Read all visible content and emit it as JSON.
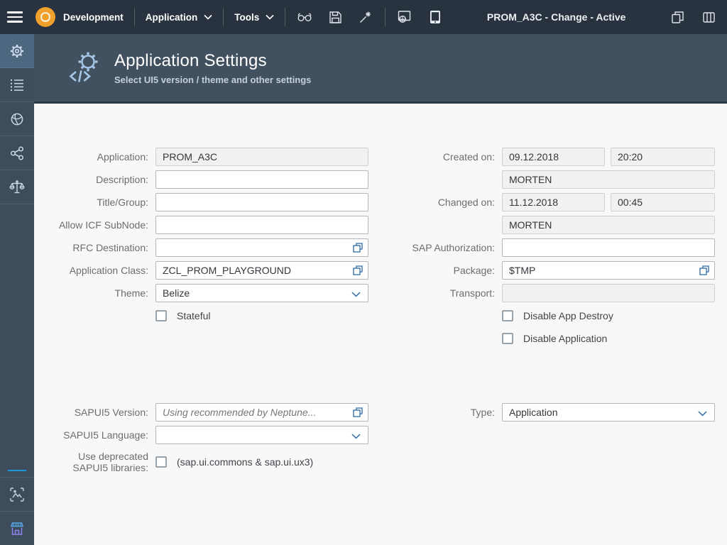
{
  "topbar": {
    "product": "Development",
    "menu_application": "Application",
    "menu_tools": "Tools",
    "title": "PROM_A3C - Change - Active",
    "icons": [
      "hamburger-icon",
      "glasses-icon",
      "save-icon",
      "wand-icon",
      "browser-preview-icon",
      "tablet-icon",
      "copy-icon",
      "columns-icon"
    ]
  },
  "sidebar": {
    "items": [
      "settings",
      "list",
      "globe",
      "share",
      "scales"
    ],
    "bottom_items": [
      "image-capture",
      "store"
    ],
    "active_item": "settings",
    "accent_line_color": "#1e97dd"
  },
  "header": {
    "title": "Application Settings",
    "subtitle": "Select UI5 version / theme and other settings",
    "icon": "gear-code-icon"
  },
  "colors": {
    "topbar_bg": "#28333f",
    "sidebar_bg": "#3e4d5c",
    "header_bg": "#42515f",
    "accent_blue": "#2b69a8",
    "logo_orange": "#efa12c"
  },
  "form": {
    "application": {
      "label": "Application:",
      "value": "PROM_A3C"
    },
    "description": {
      "label": "Description:",
      "value": ""
    },
    "title_group": {
      "label": "Title/Group:",
      "value": ""
    },
    "allow_icf": {
      "label": "Allow ICF SubNode:",
      "value": ""
    },
    "rfc_destination": {
      "label": "RFC Destination:",
      "value": ""
    },
    "application_class": {
      "label": "Application Class:",
      "value": "ZCL_PROM_PLAYGROUND"
    },
    "theme": {
      "label": "Theme:",
      "value": "Belize"
    },
    "stateful": {
      "label": "Stateful",
      "checked": false
    },
    "created_on": {
      "label": "Created on:",
      "date": "09.12.2018",
      "time": "20:20",
      "user": "MORTEN"
    },
    "changed_on": {
      "label": "Changed on:",
      "date": "11.12.2018",
      "time": "00:45",
      "user": "MORTEN"
    },
    "sap_authorization": {
      "label": "SAP Authorization:",
      "value": ""
    },
    "package": {
      "label": "Package:",
      "value": "$TMP"
    },
    "transport": {
      "label": "Transport:",
      "value": ""
    },
    "disable_app_destroy": {
      "label": "Disable App Destroy",
      "checked": false
    },
    "disable_application": {
      "label": "Disable Application",
      "checked": false
    },
    "sapui5_version": {
      "label": "SAPUI5 Version:",
      "value": "",
      "placeholder": "Using recommended by Neptune..."
    },
    "sapui5_language": {
      "label": "SAPUI5 Language:",
      "value": ""
    },
    "use_deprecated": {
      "label": "Use deprecated SAPUI5 libraries:",
      "text": "(sap.ui.commons & sap.ui.ux3)",
      "checked": false
    },
    "type": {
      "label": "Type:",
      "value": "Application"
    }
  }
}
